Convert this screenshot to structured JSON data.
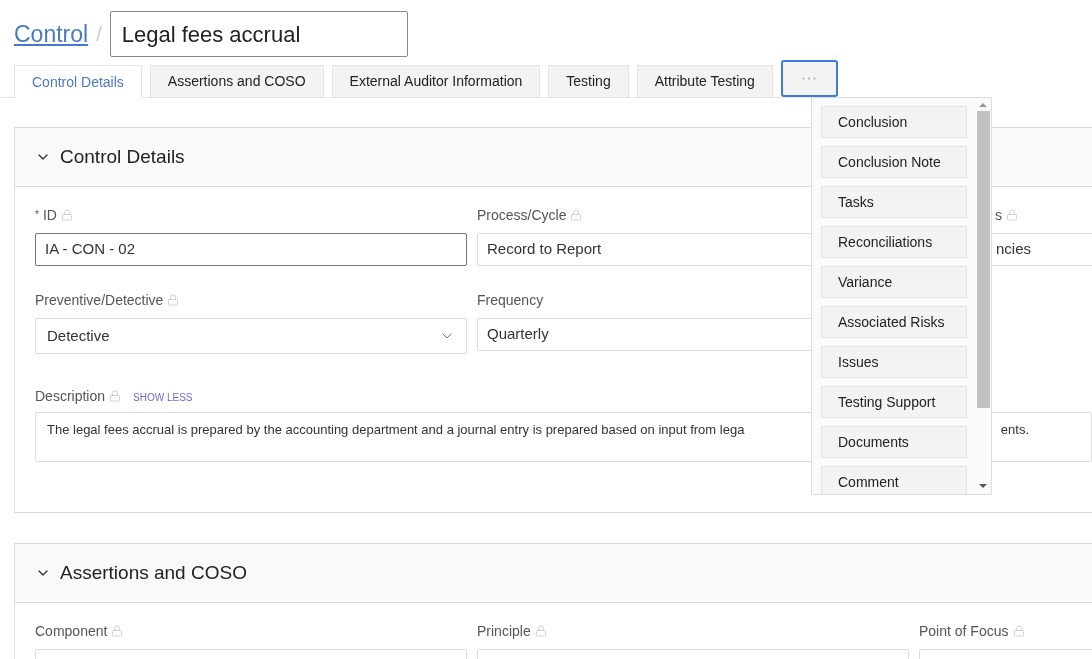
{
  "breadcrumb": {
    "link": "Control",
    "separator": "/"
  },
  "title_field": {
    "value": "Legal fees accrual"
  },
  "tabs": [
    {
      "label": "Control Details",
      "selected": true
    },
    {
      "label": "Assertions and COSO",
      "selected": false
    },
    {
      "label": "External Auditor Information",
      "selected": false
    },
    {
      "label": "Testing",
      "selected": false
    },
    {
      "label": "Attribute Testing",
      "selected": false
    }
  ],
  "more_tab": {
    "expanded": true
  },
  "more_menu": {
    "items": [
      "Conclusion",
      "Conclusion Note",
      "Tasks",
      "Reconciliations",
      "Variance",
      "Associated Risks",
      "Issues",
      "Testing Support",
      "Documents",
      "Comment"
    ]
  },
  "sections": [
    {
      "title": "Control Details",
      "expanded": true,
      "rows": [
        [
          {
            "required_mark": "*",
            "label": "ID",
            "locked": true,
            "kind": "input",
            "value": "IA - CON - 02"
          },
          {
            "label": "Process/Cycle",
            "locked": true,
            "kind": "readonly",
            "value": "Record to Report"
          },
          {
            "label": "s",
            "locked": true,
            "kind": "clipped",
            "value": "ncies"
          }
        ],
        [
          {
            "label": "Preventive/Detective",
            "locked": true,
            "kind": "select",
            "value": "Detective"
          },
          {
            "label": "Frequency",
            "locked": false,
            "kind": "readonly",
            "value": "Quarterly"
          }
        ]
      ],
      "description": {
        "label": "Description",
        "locked": true,
        "link": "SHOW LESS",
        "text_start": "The legal fees accrual is prepared by the accounting department and a journal entry is prepared based on input from lega",
        "text_end": "ents."
      }
    },
    {
      "title": "Assertions and COSO",
      "expanded": true,
      "rows": [
        [
          {
            "label": "Component",
            "locked": true,
            "kind": "select"
          },
          {
            "label": "Principle",
            "locked": true,
            "kind": "select"
          },
          {
            "label": "Point of Focus",
            "locked": true,
            "kind": "select"
          }
        ]
      ]
    }
  ]
}
